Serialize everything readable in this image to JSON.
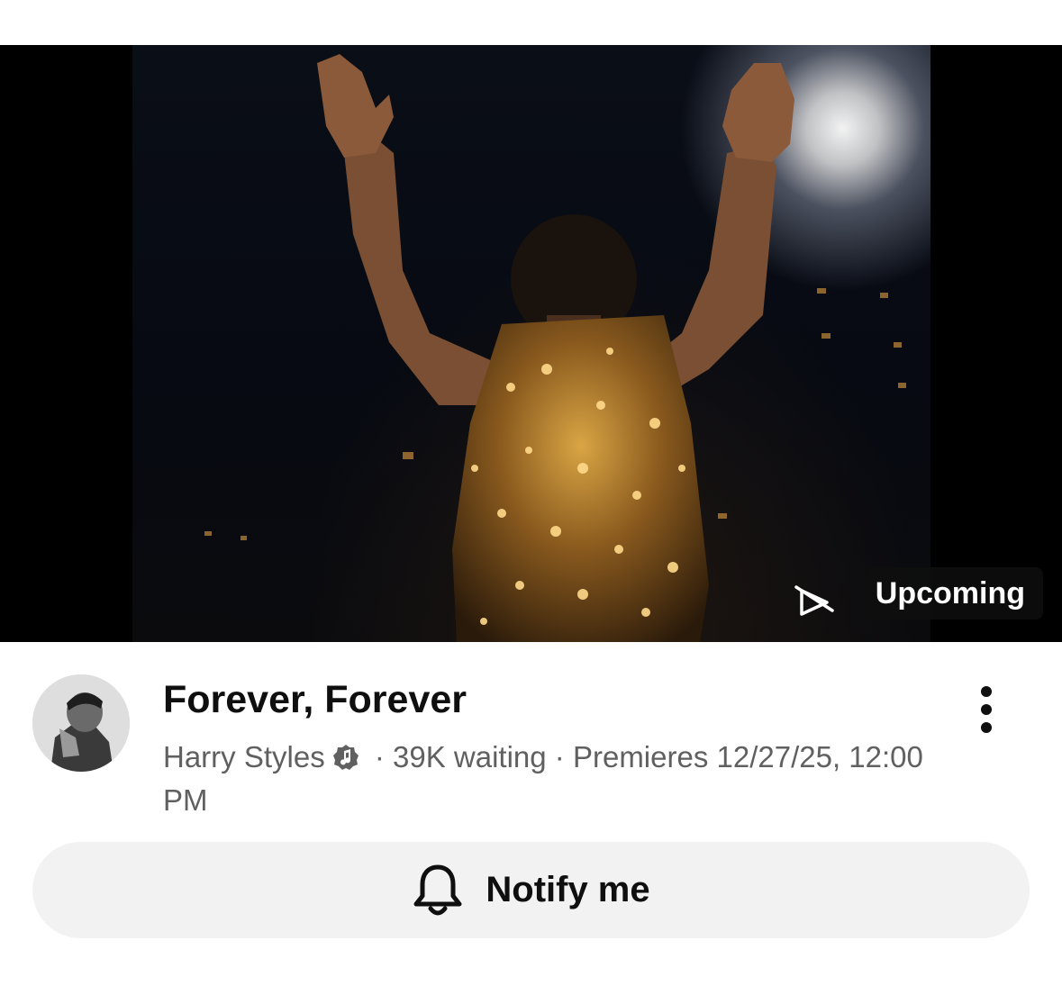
{
  "video": {
    "status_badge": "Upcoming",
    "status_icon": "premiere-off-icon"
  },
  "channel": {
    "name": "Harry Styles",
    "verified_icon": "verified-music-icon"
  },
  "title": "Forever, Forever",
  "meta": {
    "separator": " · ",
    "waiting": "39K waiting",
    "premieres": "Premieres 12/27/25, 12:00 PM"
  },
  "actions": {
    "notify_label": "Notify me",
    "notify_icon": "bell-icon",
    "more_icon": "more-vertical-icon"
  },
  "colors": {
    "title": "#0f0f0f",
    "meta": "#606060",
    "button_bg": "#f2f2f2",
    "badge_bg": "#0f0f0f"
  }
}
